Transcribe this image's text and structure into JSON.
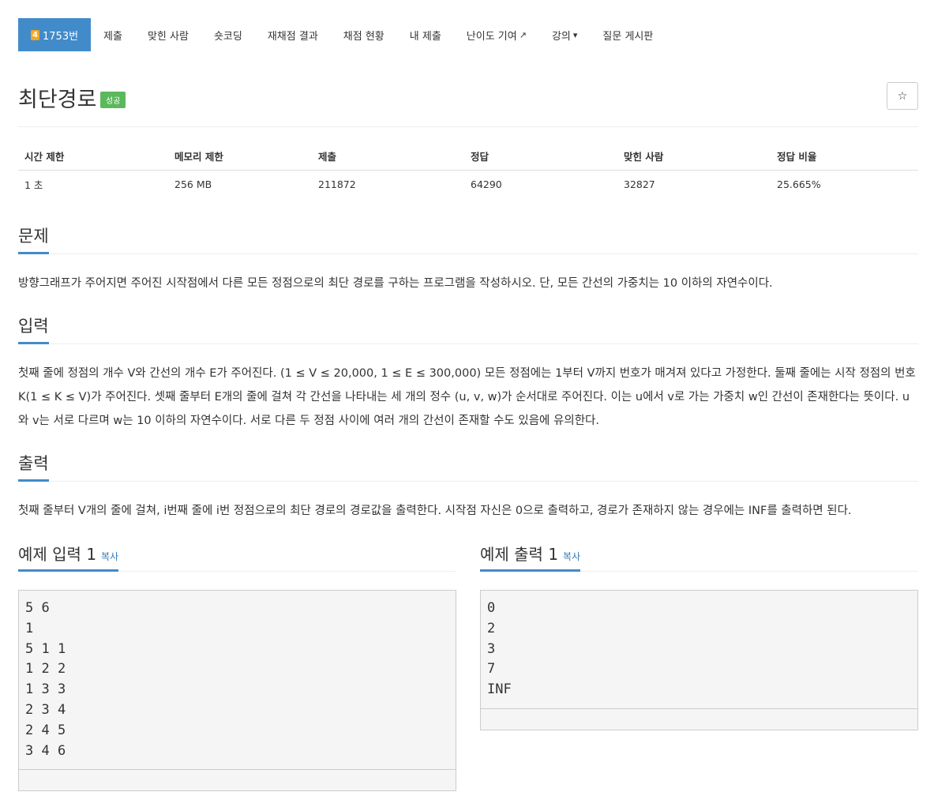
{
  "nav": {
    "problem_badge": "4",
    "problem_number": "1753번",
    "items": [
      "제출",
      "맞힌 사람",
      "숏코딩",
      "재채점 결과",
      "채점 현황",
      "내 제출",
      "난이도 기여",
      "강의",
      "질문 게시판"
    ]
  },
  "problem": {
    "title": "최단경로",
    "status_badge": "성공",
    "star": "☆"
  },
  "info": {
    "headers": [
      "시간 제한",
      "메모리 제한",
      "제출",
      "정답",
      "맞힌 사람",
      "정답 비율"
    ],
    "values": [
      "1 초",
      "256 MB",
      "211872",
      "64290",
      "32827",
      "25.665%"
    ]
  },
  "sections": {
    "description_title": "문제",
    "description": "방향그래프가 주어지면 주어진 시작점에서 다른 모든 정점으로의 최단 경로를 구하는 프로그램을 작성하시오. 단, 모든 간선의 가중치는 10 이하의 자연수이다.",
    "input_title": "입력",
    "input": "첫째 줄에 정점의 개수 V와 간선의 개수 E가 주어진다. (1 ≤ V ≤ 20,000, 1 ≤ E ≤ 300,000) 모든 정점에는 1부터 V까지 번호가 매겨져 있다고 가정한다. 둘째 줄에는 시작 정점의 번호 K(1 ≤ K ≤ V)가 주어진다. 셋째 줄부터 E개의 줄에 걸쳐 각 간선을 나타내는 세 개의 정수 (u, v, w)가 순서대로 주어진다. 이는 u에서 v로 가는 가중치 w인 간선이 존재한다는 뜻이다. u와 v는 서로 다르며 w는 10 이하의 자연수이다. 서로 다른 두 정점 사이에 여러 개의 간선이 존재할 수도 있음에 유의한다.",
    "output_title": "출력",
    "output": "첫째 줄부터 V개의 줄에 걸쳐, i번째 줄에 i번 정점으로의 최단 경로의 경로값을 출력한다. 시작점 자신은 0으로 출력하고, 경로가 존재하지 않는 경우에는 INF를 출력하면 된다."
  },
  "samples": {
    "input_title": "예제 입력 1",
    "output_title": "예제 출력 1",
    "copy_label": "복사",
    "input": "5 6\n1\n5 1 1\n1 2 2\n1 3 3\n2 3 4\n2 4 5\n3 4 6",
    "output": "0\n2\n3\n7\nINF"
  },
  "colors": {
    "accent": "#428bca",
    "success": "#5cb85c",
    "tier": "#f5a623"
  }
}
